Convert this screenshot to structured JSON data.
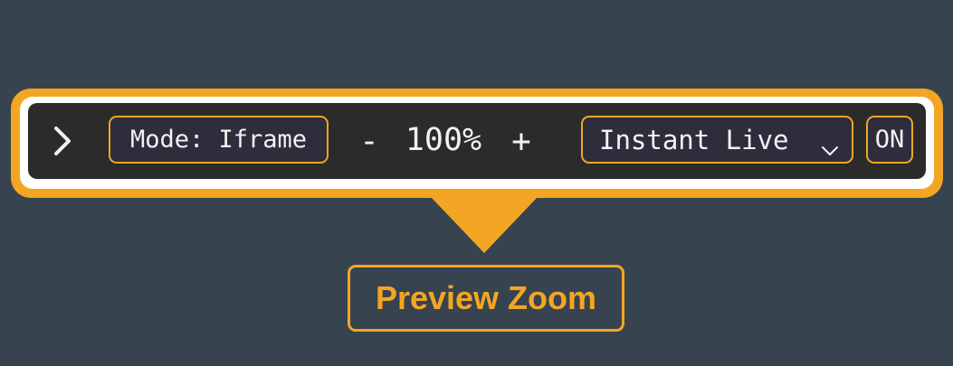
{
  "colors": {
    "background": "#37434f",
    "accent": "#f3a623",
    "toolbar": "#2b2b2b",
    "chip": "#2f2d3c",
    "text": "#f2f2f2"
  },
  "toolbar": {
    "collapse_icon": "chevron-right-icon",
    "mode_label": "Mode: Iframe",
    "zoom": {
      "decrease_label": "-",
      "value_label": "100%",
      "increase_label": "+"
    },
    "live_mode": {
      "selected": "Instant Live",
      "dropdown_icon": "chevron-down-icon"
    },
    "toggle_label": "ON"
  },
  "callout": {
    "label": "Preview Zoom"
  }
}
